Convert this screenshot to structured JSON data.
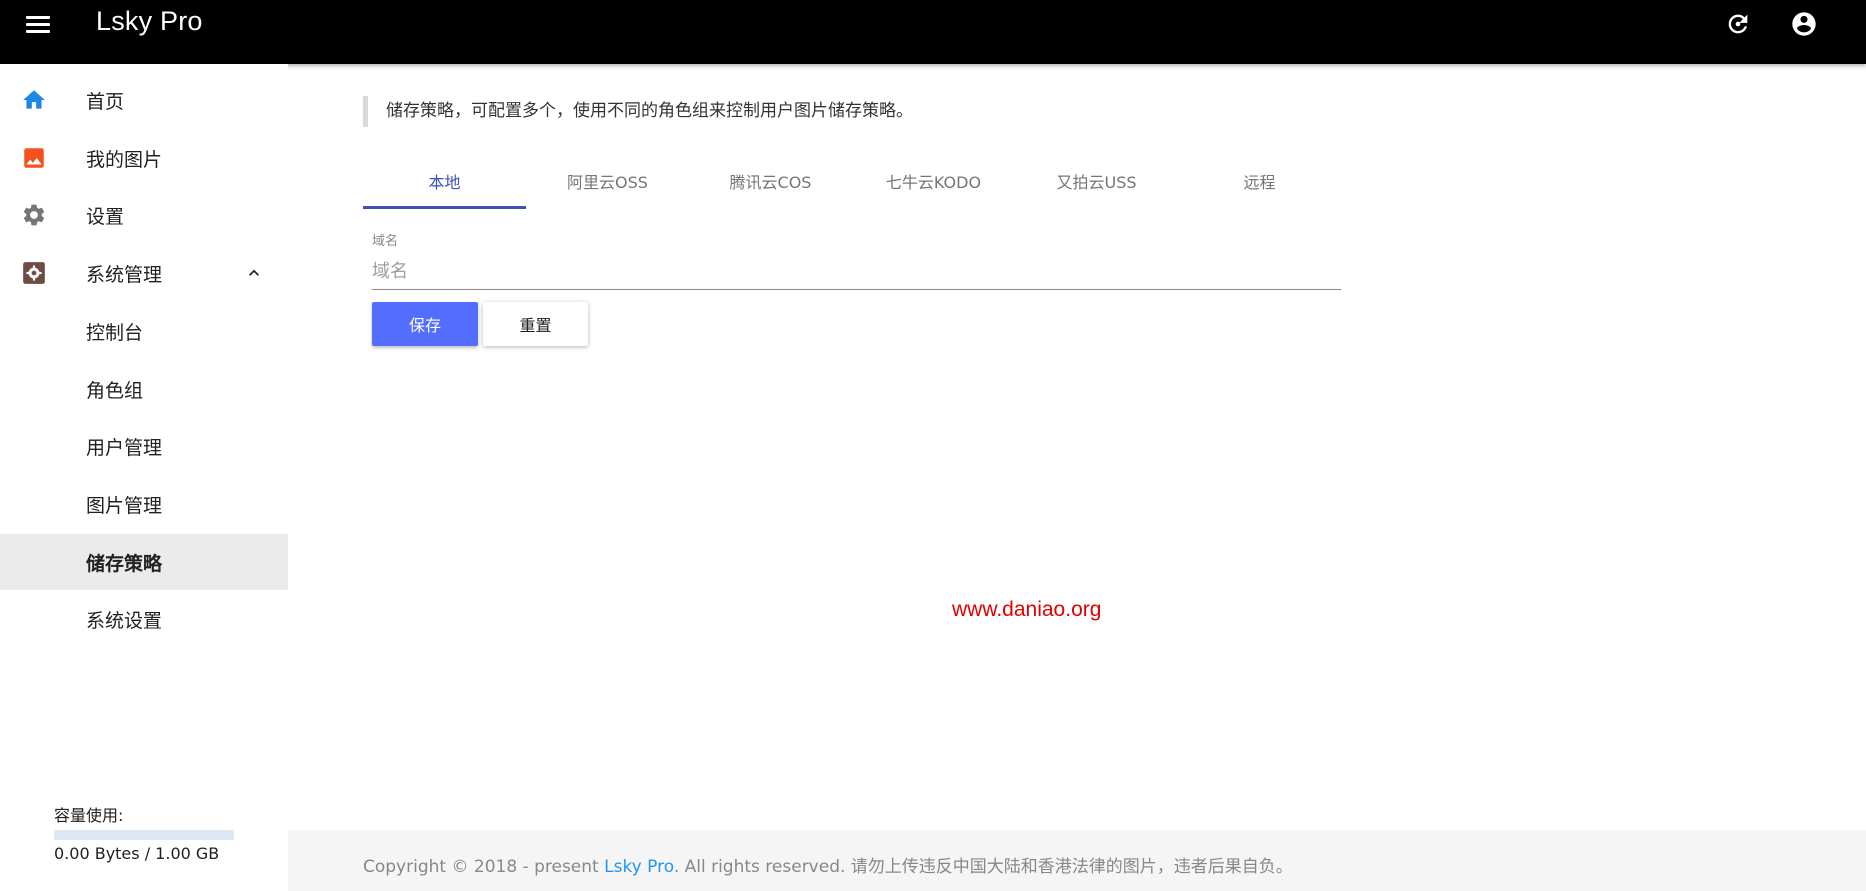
{
  "app": {
    "title": "Lsky Pro",
    "accent_color": "#3f51b5",
    "primary_button_color": "#536dfe"
  },
  "topbar": {
    "menu_icon": "menu-icon",
    "refresh_icon": "refresh-icon",
    "account_icon": "account-circle-icon"
  },
  "sidebar": {
    "items": [
      {
        "label": "首页",
        "icon": "home-icon"
      },
      {
        "label": "我的图片",
        "icon": "image-icon"
      },
      {
        "label": "设置",
        "icon": "gear-icon"
      },
      {
        "label": "系统管理",
        "icon": "admin-settings-icon",
        "expanded": true
      },
      {
        "label": "控制台"
      },
      {
        "label": "角色组"
      },
      {
        "label": "用户管理"
      },
      {
        "label": "图片管理"
      },
      {
        "label": "储存策略",
        "active": true
      },
      {
        "label": "系统设置"
      }
    ],
    "storage": {
      "label": "容量使用:",
      "value": "0.00 Bytes / 1.00 GB",
      "used_fraction": 0.0
    }
  },
  "main": {
    "notice": "储存策略，可配置多个，使用不同的角色组来控制用户图片储存策略。",
    "tabs": [
      {
        "label": "本地",
        "active": true
      },
      {
        "label": "阿里云OSS"
      },
      {
        "label": "腾讯云COS"
      },
      {
        "label": "七牛云KODO"
      },
      {
        "label": "又拍云USS"
      },
      {
        "label": "远程"
      }
    ],
    "domain_field": {
      "label": "域名",
      "placeholder": "域名",
      "value": ""
    },
    "save_label": "保存",
    "reset_label": "重置"
  },
  "watermark": "www.daniao.org",
  "footer": {
    "prefix": "Copyright © 2018 - present ",
    "link": "Lsky Pro",
    "suffix": ". All rights reserved. 请勿上传违反中国大陆和香港法律的图片，违者后果自负。"
  }
}
